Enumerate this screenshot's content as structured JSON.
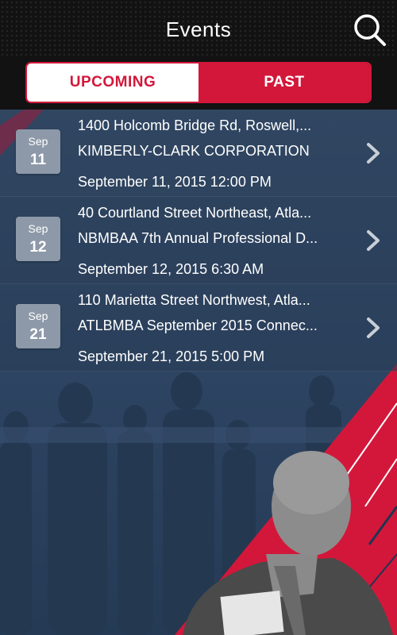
{
  "header": {
    "title": "Events",
    "search_icon": "search-icon"
  },
  "tabs": [
    {
      "label": "UPCOMING",
      "selected": false
    },
    {
      "label": "PAST",
      "selected": true
    }
  ],
  "events": [
    {
      "month": "Sep",
      "day": "11",
      "address": "1400 Holcomb Bridge Rd, Roswell,...",
      "name": "KIMBERLY-CLARK CORPORATION",
      "datetime": "September 11, 2015 12:00 PM"
    },
    {
      "month": "Sep",
      "day": "12",
      "address": "40 Courtland Street Northeast, Atla...",
      "name": "NBMBAA 7th Annual Professional D...",
      "datetime": "September 12, 2015 6:30 AM"
    },
    {
      "month": "Sep",
      "day": "21",
      "address": "110 Marietta Street Northwest, Atla...",
      "name": "ATLBMBA September 2015 Connec...",
      "datetime": "September 21, 2015 5:00 PM"
    }
  ],
  "colors": {
    "accent": "#d3173a",
    "header_bg": "#121212",
    "background": "#2f4560"
  }
}
